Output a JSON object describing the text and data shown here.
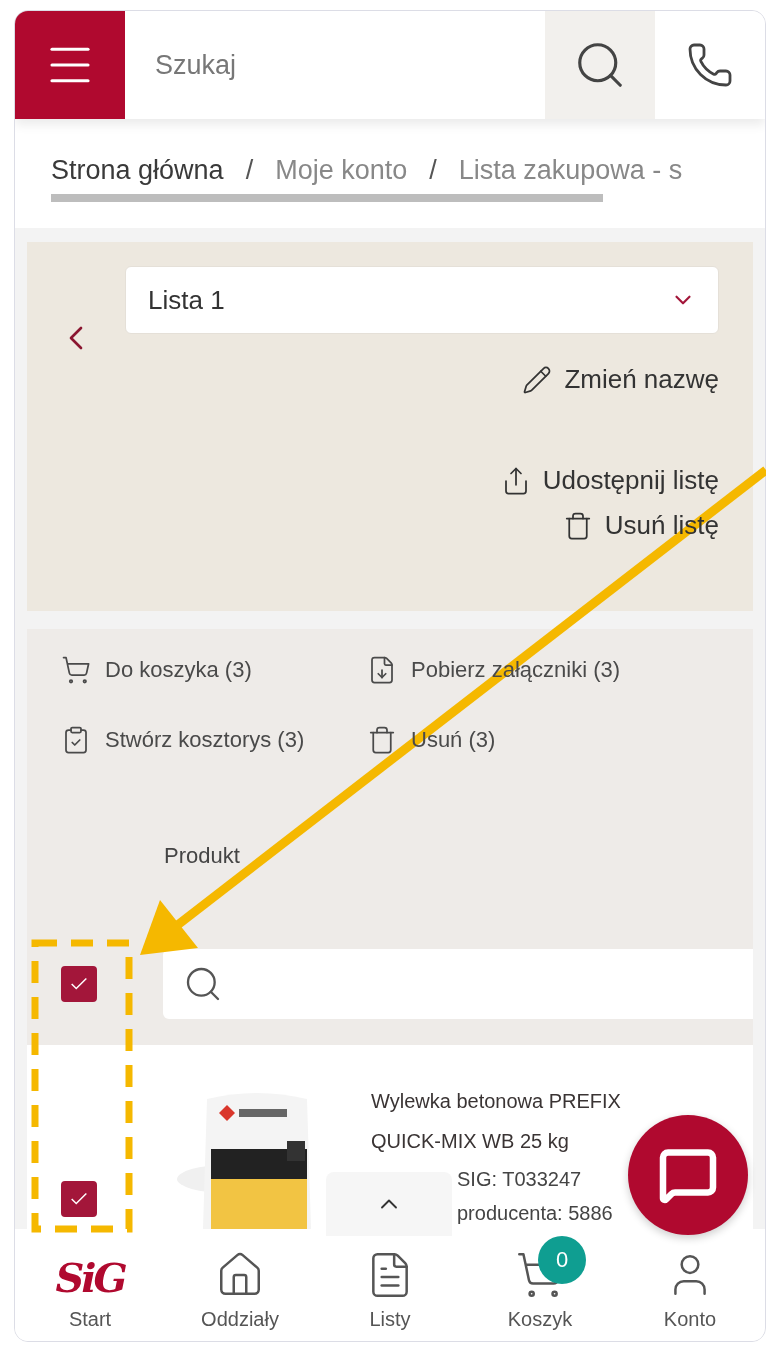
{
  "header": {
    "search": {
      "placeholder": "Szukaj"
    }
  },
  "breadcrumb": [
    {
      "label": "Strona główna"
    },
    {
      "label": "Moje konto"
    },
    {
      "label": "Lista zakupowa - s"
    }
  ],
  "breadcrumb_separator": "/",
  "list_selector": {
    "value": "Lista 1"
  },
  "list_actions": [
    {
      "kind": "rename",
      "label": "Zmień nazwę"
    },
    {
      "kind": "share",
      "label": "Udostępnij listę"
    },
    {
      "kind": "delete",
      "label": "Usuń listę"
    }
  ],
  "bulk_actions": [
    {
      "kind": "cart",
      "label": "Do koszyka (3)"
    },
    {
      "kind": "download",
      "label": "Pobierz załączniki (3)"
    },
    {
      "kind": "estimate",
      "label": "Stwórz kosztorys (3)"
    },
    {
      "kind": "delete",
      "label": "Usuń (3)"
    }
  ],
  "table": {
    "column": "Produkt",
    "select_all": {
      "checked": true
    },
    "rows": [
      {
        "checked": true,
        "name": "Wylewka betonowa PREFIX QUICK-MIX WB 25 kg",
        "sig_code": "SIG: T033247",
        "producer_code": "producenta: 5886"
      }
    ]
  },
  "bottom_nav": [
    {
      "kind": "logo",
      "logo": "SiG",
      "label": "Start"
    },
    {
      "kind": "home",
      "label": "Oddziały"
    },
    {
      "kind": "list",
      "label": "Listy"
    },
    {
      "kind": "cart",
      "label": "Koszyk",
      "badge": "0"
    },
    {
      "kind": "user",
      "label": "Konto"
    }
  ]
}
